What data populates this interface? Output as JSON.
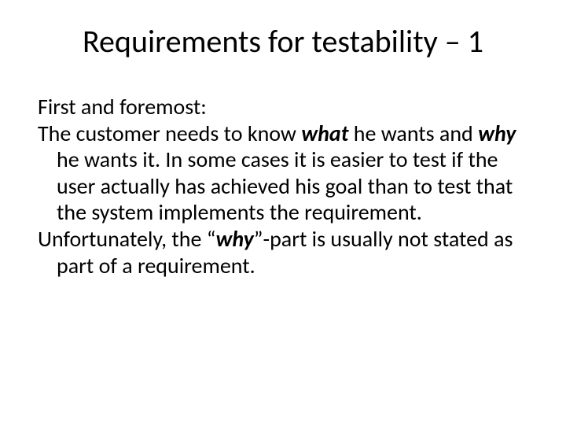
{
  "slide": {
    "title": "Requirements for testability – 1",
    "line1": "First and foremost:",
    "p2_a": "The customer needs to know ",
    "p2_what": "what",
    "p2_b": " he wants and ",
    "p2_why": "why",
    "p2_c": " he wants it. In some cases it is easier to test if the user actually has achieved his goal than to test that the system implements the requirement.",
    "p3_a": "Unfortunately, the “",
    "p3_why": "why",
    "p3_b": "”-part is usually not stated as part of a requirement."
  }
}
